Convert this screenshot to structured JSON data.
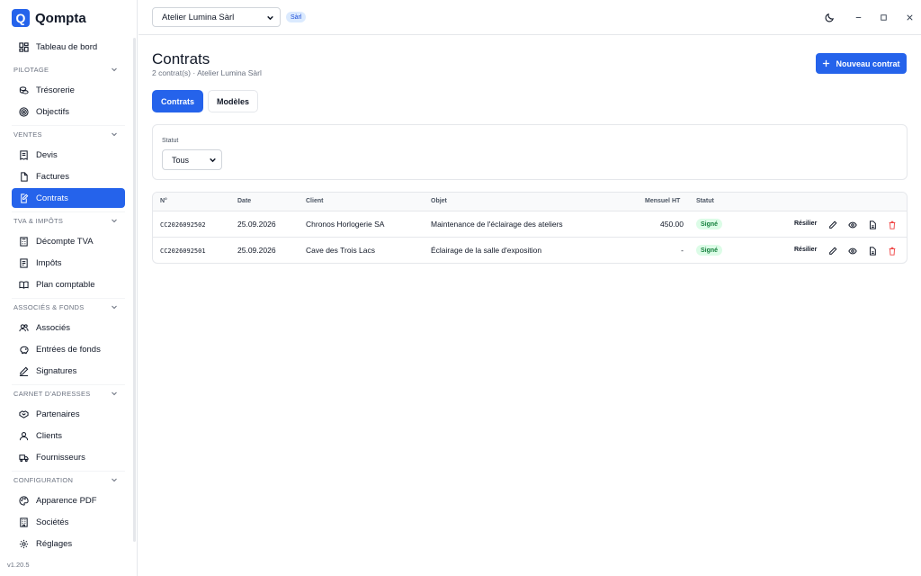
{
  "app": {
    "name": "Qompta",
    "logo_letter": "Q",
    "version": "v1.20.5"
  },
  "sidebar": {
    "top_item": {
      "label": "Tableau de bord",
      "icon": "dashboard-icon"
    },
    "sections": [
      {
        "title": "PILOTAGE",
        "items": [
          {
            "label": "Trésorerie",
            "icon": "coins-icon"
          },
          {
            "label": "Objectifs",
            "icon": "target-icon"
          }
        ]
      },
      {
        "title": "VENTES",
        "items": [
          {
            "label": "Devis",
            "icon": "receipt-icon"
          },
          {
            "label": "Factures",
            "icon": "file-icon"
          },
          {
            "label": "Contrats",
            "icon": "file-edit-icon",
            "active": true
          }
        ]
      },
      {
        "title": "TVA & IMPÔTS",
        "items": [
          {
            "label": "Décompte TVA",
            "icon": "calculator-icon"
          },
          {
            "label": "Impôts",
            "icon": "document-icon"
          },
          {
            "label": "Plan comptable",
            "icon": "book-icon"
          }
        ]
      },
      {
        "title": "ASSOCIÉS & FONDS",
        "items": [
          {
            "label": "Associés",
            "icon": "users-icon"
          },
          {
            "label": "Entrées de fonds",
            "icon": "piggy-bank-icon"
          },
          {
            "label": "Signatures",
            "icon": "pen-icon"
          }
        ]
      },
      {
        "title": "CARNET D'ADRESSES",
        "items": [
          {
            "label": "Partenaires",
            "icon": "handshake-icon"
          },
          {
            "label": "Clients",
            "icon": "user-icon"
          },
          {
            "label": "Fournisseurs",
            "icon": "truck-icon"
          }
        ]
      },
      {
        "title": "CONFIGURATION",
        "items": [
          {
            "label": "Apparence PDF",
            "icon": "palette-icon"
          },
          {
            "label": "Sociétés",
            "icon": "building-icon"
          },
          {
            "label": "Réglages",
            "icon": "gear-icon"
          }
        ]
      }
    ]
  },
  "topbar": {
    "company": "Atelier Lumina Sàrl",
    "company_badge": "Sàrl"
  },
  "page": {
    "title": "Contrats",
    "subtitle": "2 contrat(s) · Atelier Lumina Sàrl",
    "new_button": "Nouveau contrat",
    "tabs": [
      {
        "label": "Contrats",
        "active": true
      },
      {
        "label": "Modèles",
        "active": false
      }
    ],
    "filter": {
      "label": "Statut",
      "value": "Tous"
    }
  },
  "table": {
    "headers": {
      "num": "N°",
      "date": "Date",
      "client": "Client",
      "objet": "Objet",
      "mensuel": "Mensuel HT",
      "statut": "Statut"
    },
    "rows": [
      {
        "num": "CC2026092502",
        "date": "25.09.2026",
        "client": "Chronos Horlogerie SA",
        "objet": "Maintenance de l'éclairage des ateliers",
        "mensuel": "450.00",
        "statut": "Signé",
        "action": "Résilier"
      },
      {
        "num": "CC2026092501",
        "date": "25.09.2026",
        "client": "Cave des Trois Lacs",
        "objet": "Éclairage de la salle d'exposition",
        "mensuel": "-",
        "statut": "Signé",
        "action": "Résilier"
      }
    ]
  },
  "colors": {
    "accent": "#2563eb",
    "success_bg": "#dcfce7",
    "success_text": "#15803d",
    "danger": "#ef4444"
  }
}
